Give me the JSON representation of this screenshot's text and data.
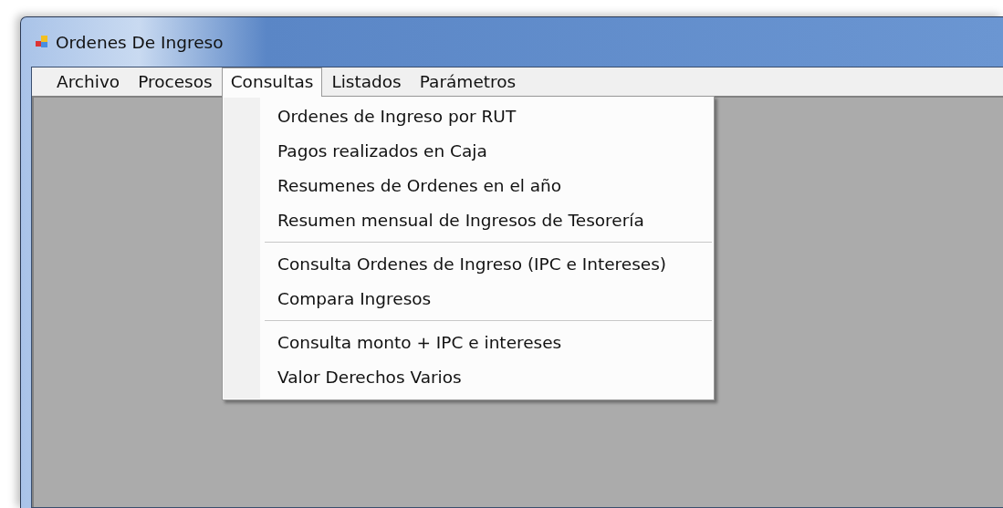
{
  "window": {
    "title": "Ordenes De Ingreso"
  },
  "menu": [
    {
      "label": "Archivo",
      "selected": false
    },
    {
      "label": "Procesos",
      "selected": false
    },
    {
      "label": "Consultas",
      "selected": true
    },
    {
      "label": "Listados",
      "selected": false
    },
    {
      "label": "Parámetros",
      "selected": false
    }
  ],
  "dropdown": [
    {
      "kind": "item",
      "label": "Ordenes de Ingreso por RUT"
    },
    {
      "kind": "item",
      "label": "Pagos realizados en Caja"
    },
    {
      "kind": "item",
      "label": "Resumenes de Ordenes en el año"
    },
    {
      "kind": "item",
      "label": "Resumen mensual de Ingresos de Tesorería"
    },
    {
      "kind": "separator"
    },
    {
      "kind": "item",
      "label": "Consulta Ordenes de Ingreso (IPC e Intereses)"
    },
    {
      "kind": "item",
      "label": "Compara Ingresos"
    },
    {
      "kind": "separator"
    },
    {
      "kind": "item",
      "label": "Consulta monto + IPC e intereses"
    },
    {
      "kind": "item",
      "label": "Valor Derechos Varios"
    }
  ]
}
